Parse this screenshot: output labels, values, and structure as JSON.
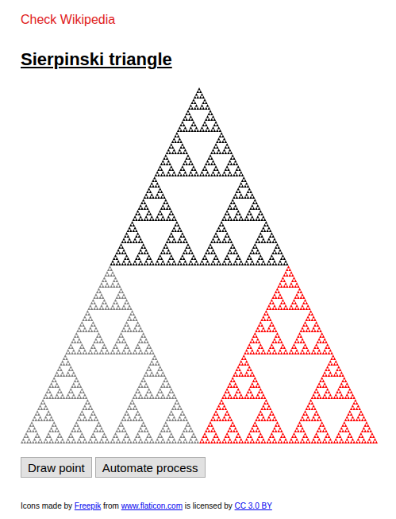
{
  "link": {
    "label": "Check Wikipedia"
  },
  "title": "Sierpinski triangle",
  "triangle": {
    "parts": [
      {
        "color": "#000000"
      },
      {
        "color": "#808080"
      },
      {
        "color": "#ff0000"
      }
    ]
  },
  "buttons": [
    "Draw point",
    "Automate process"
  ],
  "footer": [
    {
      "kind": "text",
      "text": "Icons made by "
    },
    {
      "kind": "link",
      "text": "Freepik"
    },
    {
      "kind": "text",
      "text": " from "
    },
    {
      "kind": "link",
      "text": "www.flaticon.com"
    },
    {
      "kind": "text",
      "text": " is licensed by "
    },
    {
      "kind": "link",
      "text": "CC 3.0 BY"
    }
  ]
}
